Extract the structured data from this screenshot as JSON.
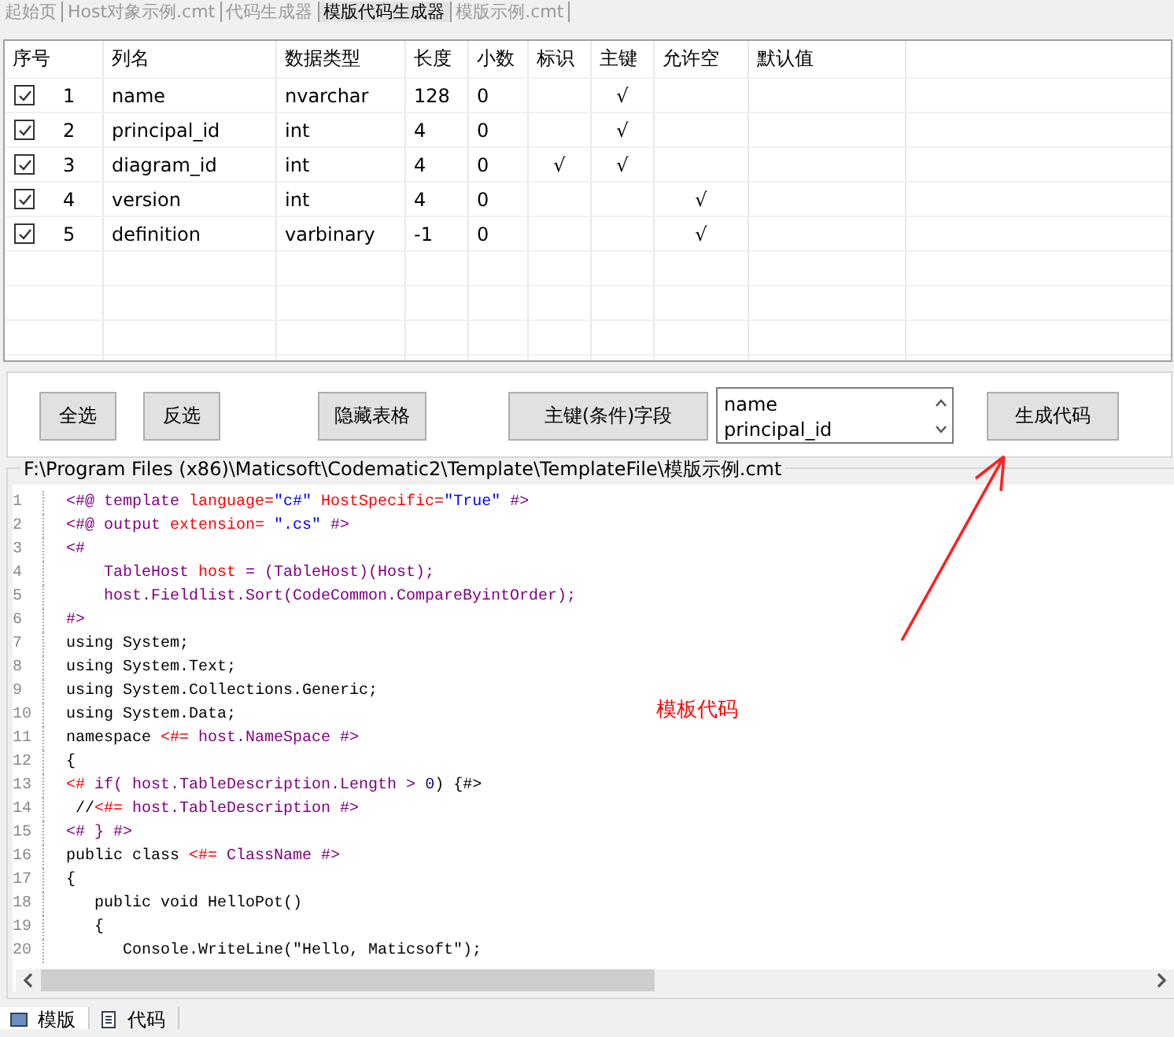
{
  "tabs": [
    {
      "label": "起始页",
      "selected": false
    },
    {
      "label": "Host对象示例.cmt",
      "selected": false
    },
    {
      "label": "代码生成器",
      "selected": false
    },
    {
      "label": "模版代码生成器",
      "selected": true
    },
    {
      "label": "模版示例.cmt",
      "selected": false
    }
  ],
  "table": {
    "columns": [
      "序号",
      "列名",
      "数据类型",
      "长度",
      "小数",
      "标识",
      "主键",
      "允许空",
      "默认值"
    ],
    "rows": [
      {
        "checked": true,
        "no": "1",
        "name": "name",
        "type": "nvarchar",
        "length": "128",
        "scale": "0",
        "primary_key": "√"
      },
      {
        "checked": true,
        "no": "2",
        "name": "principal_id",
        "type": "int",
        "length": "4",
        "scale": "0",
        "primary_key": "√"
      },
      {
        "checked": true,
        "no": "3",
        "name": "diagram_id",
        "type": "int",
        "length": "4",
        "scale": "0",
        "identity": "√",
        "primary_key": "√"
      },
      {
        "checked": true,
        "no": "4",
        "name": "version",
        "type": "int",
        "length": "4",
        "scale": "0",
        "allow_null": "√"
      },
      {
        "checked": true,
        "no": "5",
        "name": "definition",
        "type": "varbinary",
        "length": "-1",
        "scale": "0",
        "allow_null": "√"
      }
    ]
  },
  "toolbar": {
    "buttons": [
      "全选",
      "反选",
      "隐藏表格",
      "主键(条件)字段"
    ],
    "key_fields": [
      "name",
      "principal_id"
    ],
    "generate_button": "生成代码"
  },
  "editor": {
    "path": "F:\\Program Files (x86)\\Maticsoft\\Codematic2\\Template\\TemplateFile\\模版示例.cmt",
    "lines": [
      {
        "no": "1",
        "segs": [
          {
            "kind": "code",
            "t": "<#@ template "
          },
          {
            "kind": "attr",
            "t": "language="
          },
          {
            "kind": "str",
            "t": "\"c#\" "
          },
          {
            "kind": "attr",
            "t": "HostSpecific="
          },
          {
            "kind": "str",
            "t": "\"True\""
          },
          {
            "kind": "code",
            "t": " #>"
          }
        ]
      },
      {
        "no": "2",
        "segs": [
          {
            "kind": "code",
            "t": "<#@ output "
          },
          {
            "kind": "attr",
            "t": "extension="
          },
          {
            "kind": "str",
            "t": " \".cs\""
          },
          {
            "kind": "code",
            "t": " #>"
          }
        ]
      },
      {
        "no": "3",
        "segs": [
          {
            "kind": "code",
            "t": "<#"
          }
        ]
      },
      {
        "no": "4",
        "segs": [
          {
            "kind": "code",
            "t": "    TableHost"
          },
          {
            "kind": "attr",
            "t": " host"
          },
          {
            "kind": "code",
            "t": " = (TableHost)(Host);"
          }
        ]
      },
      {
        "no": "5",
        "segs": [
          {
            "kind": "code",
            "t": "    host.Fieldlist.Sort(CodeCommon.CompareByintOrder);"
          }
        ]
      },
      {
        "no": "6",
        "segs": [
          {
            "kind": "code",
            "t": "#>"
          }
        ]
      },
      {
        "no": "7",
        "segs": [
          {
            "kind": "text",
            "t": "using System;"
          }
        ]
      },
      {
        "no": "8",
        "segs": [
          {
            "kind": "text",
            "t": "using System.Text;"
          }
        ]
      },
      {
        "no": "9",
        "segs": [
          {
            "kind": "text",
            "t": "using System.Collections.Generic;"
          }
        ]
      },
      {
        "no": "10",
        "segs": [
          {
            "kind": "text",
            "t": "using System.Data;"
          }
        ]
      },
      {
        "no": "11",
        "segs": [
          {
            "kind": "text",
            "t": "namespace "
          },
          {
            "kind": "attr",
            "t": "<#="
          },
          {
            "kind": "code",
            "t": " host.NameSpace #>"
          }
        ]
      },
      {
        "no": "12",
        "segs": [
          {
            "kind": "text",
            "t": "{"
          }
        ]
      },
      {
        "no": "13",
        "segs": [
          {
            "kind": "attr",
            "t": "<#"
          },
          {
            "kind": "code",
            "t": " if( host.TableDescription.Length > "
          },
          {
            "kind": "num",
            "t": "0"
          },
          {
            "kind": "text",
            "t": ") {#>"
          }
        ]
      },
      {
        "no": "14",
        "segs": [
          {
            "kind": "text",
            "t": " //"
          },
          {
            "kind": "attr",
            "t": "<#="
          },
          {
            "kind": "code",
            "t": " host.TableDescription #>"
          }
        ]
      },
      {
        "no": "15",
        "segs": [
          {
            "kind": "code",
            "t": "<# } #>"
          }
        ]
      },
      {
        "no": "16",
        "segs": [
          {
            "kind": "text",
            "t": "public class "
          },
          {
            "kind": "attr",
            "t": "<#="
          },
          {
            "kind": "code",
            "t": " ClassName #>"
          }
        ]
      },
      {
        "no": "17",
        "segs": [
          {
            "kind": "text",
            "t": "{"
          }
        ]
      },
      {
        "no": "18",
        "segs": [
          {
            "kind": "text",
            "t": "   public void HelloPot()"
          }
        ]
      },
      {
        "no": "19",
        "segs": [
          {
            "kind": "text",
            "t": "   {"
          }
        ]
      },
      {
        "no": "20",
        "segs": [
          {
            "kind": "text",
            "t": "      Console.WriteLine(\"Hello, Maticsoft\");"
          }
        ]
      }
    ]
  },
  "annotation": {
    "text": "模板代码"
  },
  "bottom_tabs": [
    {
      "label": "模版",
      "selected": true
    },
    {
      "label": "代码",
      "selected": false
    }
  ]
}
